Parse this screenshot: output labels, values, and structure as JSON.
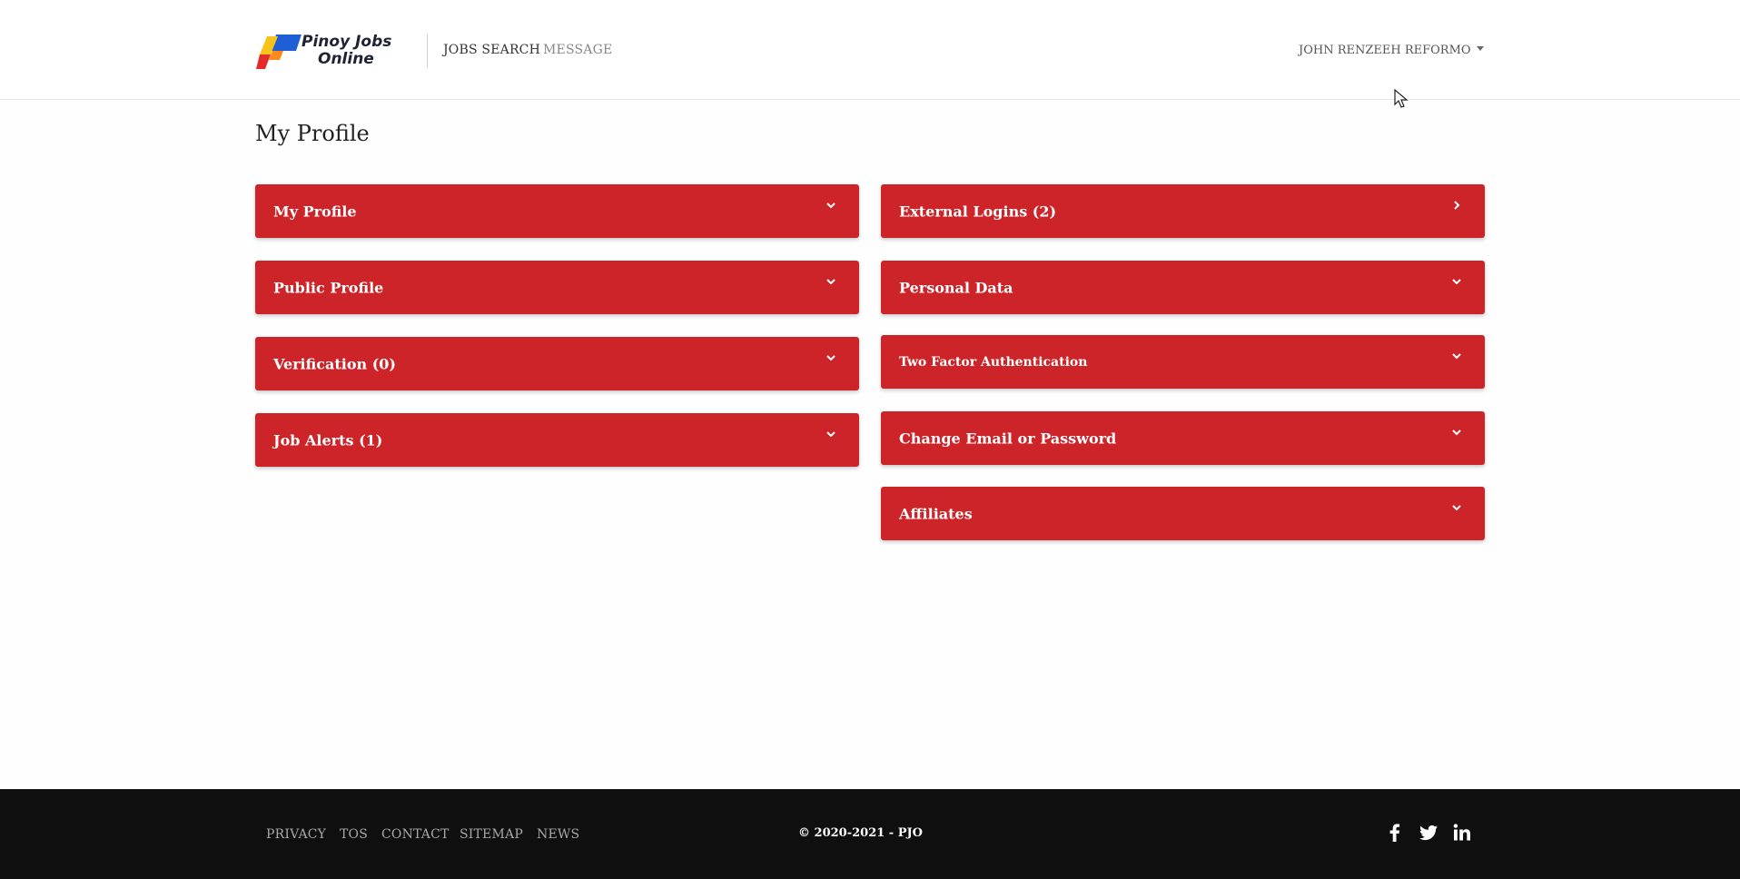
{
  "brand": {
    "logo_text_line1": "Pinoy Jobs",
    "logo_text_line2": "Online",
    "logo_colors": [
      "#1f5fd6",
      "#f7c21a",
      "#e52a2a",
      "#ff8a1c"
    ]
  },
  "nav": {
    "jobs_search": "JOBS SEARCH",
    "message": "MESSAGE",
    "user_name": "JOHN RENZEEH REFORMO"
  },
  "page": {
    "title": "My Profile"
  },
  "panels": {
    "left": [
      {
        "label": "My Profile",
        "icon": "chevron-down-icon"
      },
      {
        "label": "Public Profile",
        "icon": "chevron-down-icon"
      },
      {
        "label": "Verification (0)",
        "icon": "chevron-down-icon"
      },
      {
        "label": "Job Alerts (1)",
        "icon": "chevron-down-icon"
      }
    ],
    "right": [
      {
        "label": "External Logins (2)",
        "icon": "chevron-right-icon"
      },
      {
        "label": "Personal Data",
        "icon": "chevron-down-icon"
      },
      {
        "label": "Two Factor Authentication",
        "icon": "chevron-down-icon"
      },
      {
        "label": "Change Email or Password",
        "icon": "chevron-down-icon"
      },
      {
        "label": "Affiliates",
        "icon": "chevron-down-icon"
      }
    ],
    "color": "#cc2428"
  },
  "footer": {
    "links": [
      "PRIVACY",
      "TOS",
      "CONTACT",
      "SITEMAP",
      "NEWS"
    ],
    "copyright": "© 2020-2021 - PJO",
    "social_icons": [
      "facebook-icon",
      "twitter-icon",
      "linkedin-icon"
    ],
    "background": "#0f0f0f"
  }
}
